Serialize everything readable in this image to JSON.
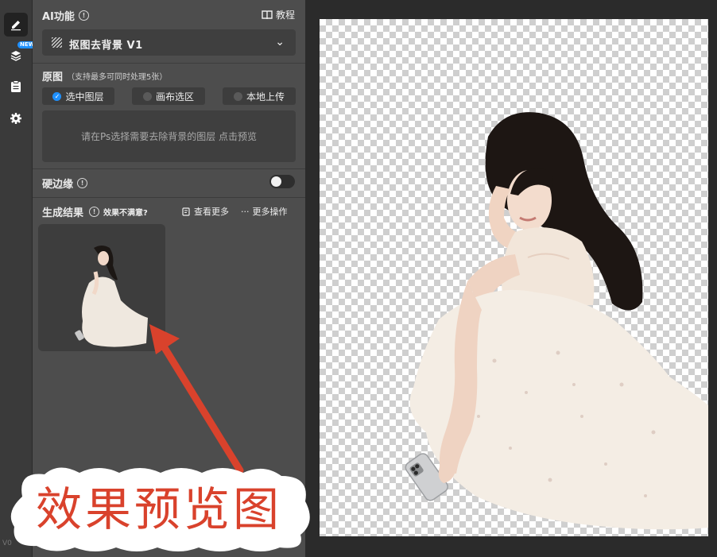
{
  "sidebar_rail": {
    "items": [
      {
        "icon": "pen-icon",
        "active": true
      },
      {
        "icon": "layers-icon",
        "badge": "NEW"
      },
      {
        "icon": "clipboard-icon"
      },
      {
        "icon": "gear-icon"
      }
    ],
    "version": "V0"
  },
  "panel": {
    "ai_title": "AI功能",
    "tutorial_label": "教程",
    "model_name": "抠图去背景 V1",
    "source": {
      "title": "原图",
      "hint": "（支持最多可同时处理5张）",
      "options": [
        {
          "label": "选中图层",
          "selected": true
        },
        {
          "label": "画布选区",
          "selected": false
        },
        {
          "label": "本地上传",
          "selected": false
        }
      ],
      "dropzone_text": "请在Ps选择需要去除背景的图层 点击预览"
    },
    "hard_edge": {
      "label": "硬边缘",
      "enabled": false
    },
    "results": {
      "title": "生成结果",
      "unsatisfied": "效果不满意?",
      "view_more": "查看更多",
      "more_actions": "更多操作"
    }
  },
  "annotation": {
    "text": "效果预览图",
    "color": "#d9422c"
  },
  "colors": {
    "accent": "#1e90ff",
    "panel": "#4d4d4d",
    "rail": "#3a3a3a"
  }
}
